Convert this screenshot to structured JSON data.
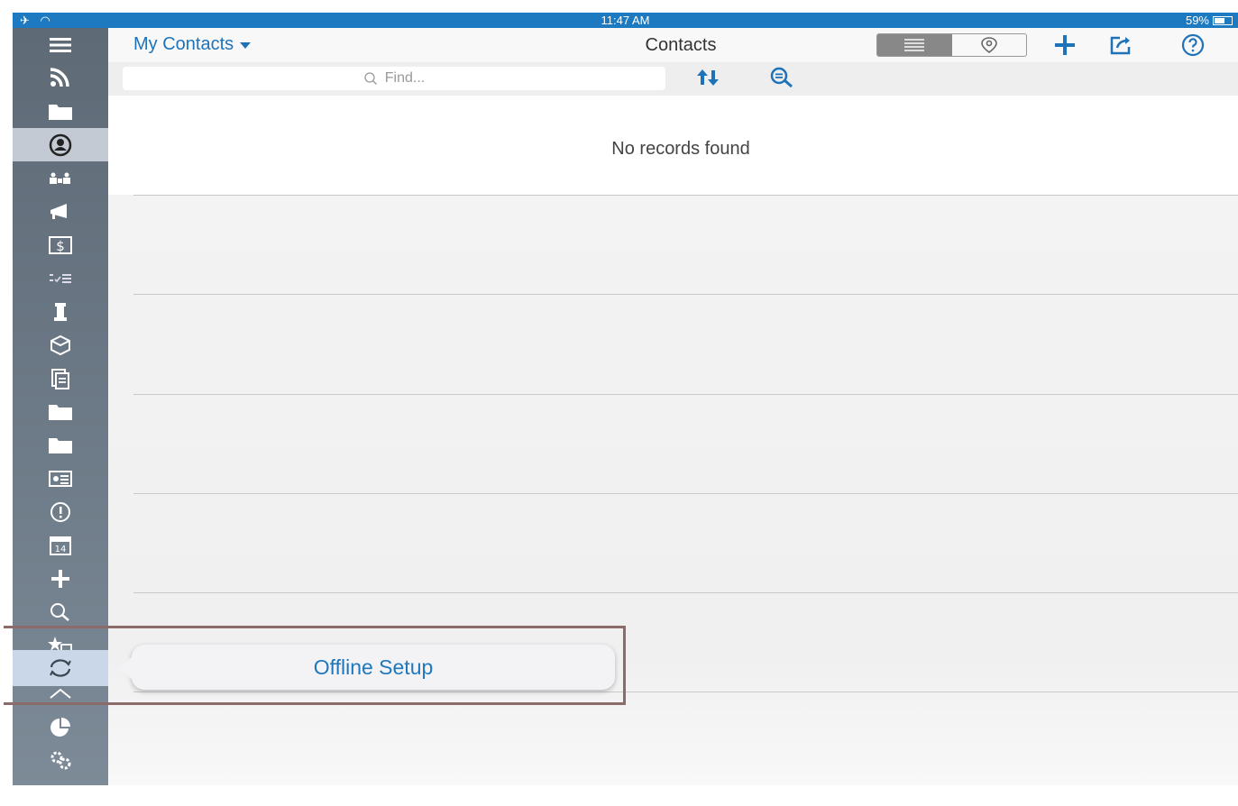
{
  "status": {
    "left_glyphs": "✈ ◠",
    "time": "11:47 AM",
    "battery": "59%",
    "battery_level": 0.59
  },
  "header": {
    "dropdown_label": "My Contacts",
    "title": "Contacts"
  },
  "find": {
    "placeholder": "Find..."
  },
  "content": {
    "empty_message": "No records found"
  },
  "tooltip": {
    "label": "Offline Setup"
  },
  "colors": {
    "accent": "#1e73b8",
    "statusbar": "#1d7ac0",
    "sidebar": "#6b7784",
    "active_item": "#c3cad3"
  },
  "sidebar": {
    "items": [
      {
        "name": "menu-icon"
      },
      {
        "name": "rss-feed-icon"
      },
      {
        "name": "folder-icon"
      },
      {
        "name": "contacts-icon",
        "active": true
      },
      {
        "name": "accounts-icon"
      },
      {
        "name": "campaigns-icon"
      },
      {
        "name": "opportunities-icon"
      },
      {
        "name": "tasks-icon"
      },
      {
        "name": "leads-icon"
      },
      {
        "name": "products-icon"
      },
      {
        "name": "documents-icon"
      },
      {
        "name": "folder-icon-2"
      },
      {
        "name": "folder-icon-3"
      },
      {
        "name": "id-card-icon"
      },
      {
        "name": "alert-icon"
      },
      {
        "name": "calendar-icon",
        "calendar_day": "14"
      },
      {
        "name": "add-icon"
      },
      {
        "name": "search-icon"
      },
      {
        "name": "favorites-icon"
      },
      {
        "name": "sync-icon",
        "active": true
      },
      {
        "name": "home-icon"
      },
      {
        "name": "reports-icon"
      },
      {
        "name": "settings-icon"
      },
      {
        "name": "more-icon"
      }
    ]
  }
}
